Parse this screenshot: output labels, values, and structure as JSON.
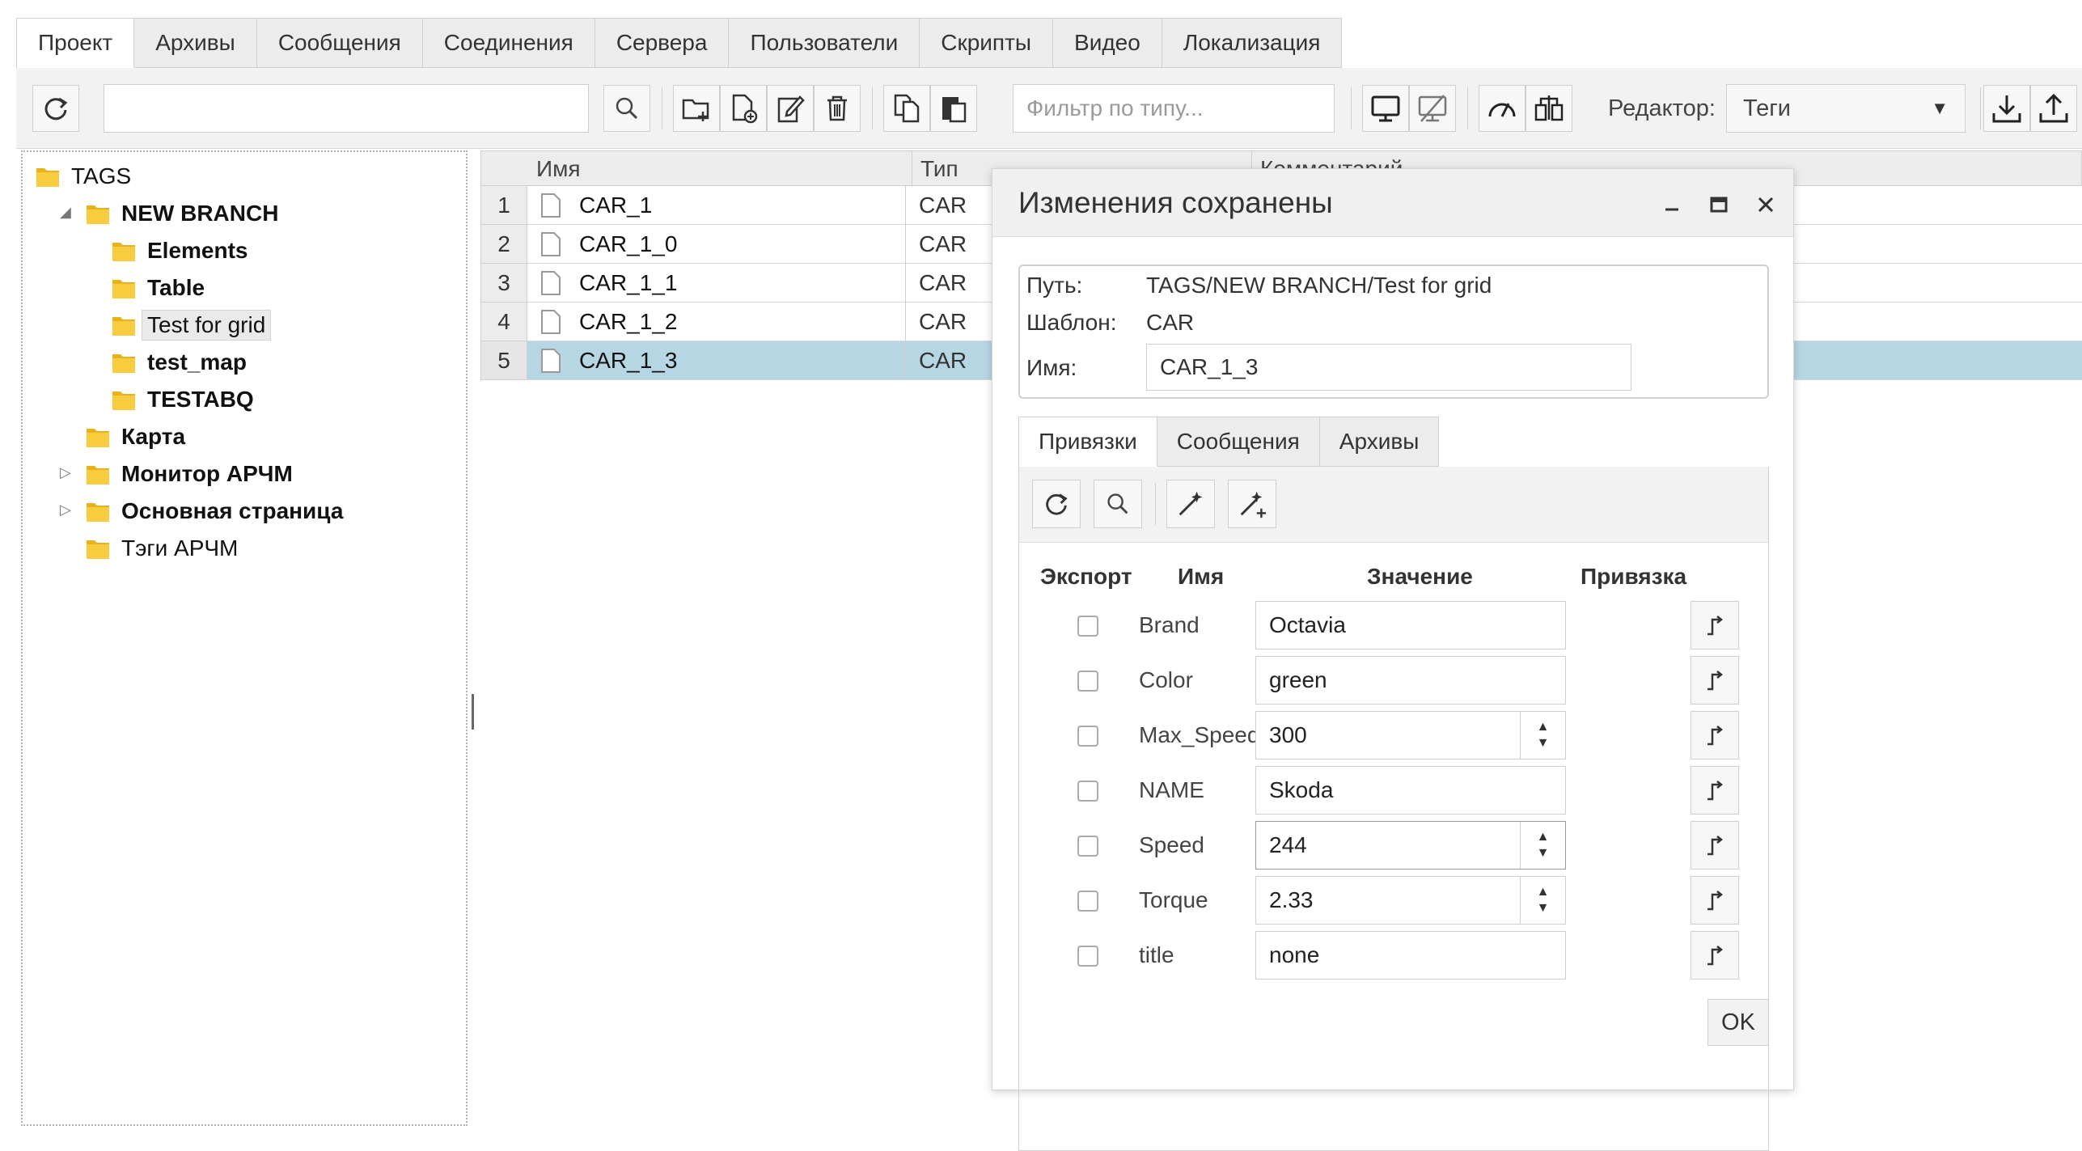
{
  "top_tabs": [
    "Проект",
    "Архивы",
    "Сообщения",
    "Соединения",
    "Сервера",
    "Пользователи",
    "Скрипты",
    "Видео",
    "Локализация"
  ],
  "toolbar": {
    "search_value": "",
    "filter_placeholder": "Фильтр по типу...",
    "editor_label": "Редактор:",
    "editor_value": "Теги"
  },
  "tree": {
    "root": "TAGS",
    "branch": "NEW BRANCH",
    "children": [
      "Elements",
      "Table",
      "Test for grid",
      "test_map",
      "TESTABQ"
    ],
    "siblings": [
      "Карта",
      "Монитор АРЧМ",
      "Основная страница",
      "Тэги АРЧМ"
    ]
  },
  "grid": {
    "columns": [
      "Имя",
      "Тип",
      "Комментарий"
    ],
    "rows": [
      {
        "num": "1",
        "name": "CAR_1",
        "type": "CAR"
      },
      {
        "num": "2",
        "name": "CAR_1_0",
        "type": "CAR"
      },
      {
        "num": "3",
        "name": "CAR_1_1",
        "type": "CAR"
      },
      {
        "num": "4",
        "name": "CAR_1_2",
        "type": "CAR"
      },
      {
        "num": "5",
        "name": "CAR_1_3",
        "type": "CAR"
      }
    ],
    "selected_row": 5
  },
  "dialog": {
    "title": "Изменения сохранены",
    "path_label": "Путь:",
    "path_value": "TAGS/NEW BRANCH/Test for grid",
    "template_label": "Шаблон:",
    "template_value": "CAR",
    "name_label": "Имя:",
    "name_value": "CAR_1_3",
    "tabs": [
      "Привязки",
      "Сообщения",
      "Архивы"
    ],
    "columns": {
      "export": "Экспорт",
      "name": "Имя",
      "value": "Значение",
      "binding": "Привязка"
    },
    "props": [
      {
        "name": "Brand",
        "value": "Octavia",
        "spin": false
      },
      {
        "name": "Color",
        "value": "green",
        "spin": false
      },
      {
        "name": "Max_Speed",
        "value": "300",
        "spin": true
      },
      {
        "name": "NAME",
        "value": "Skoda",
        "spin": false
      },
      {
        "name": "Speed",
        "value": "244",
        "spin": true
      },
      {
        "name": "Torque",
        "value": "2.33",
        "spin": true
      },
      {
        "name": "title",
        "value": "none",
        "spin": false
      }
    ],
    "ok_label": "OK"
  }
}
